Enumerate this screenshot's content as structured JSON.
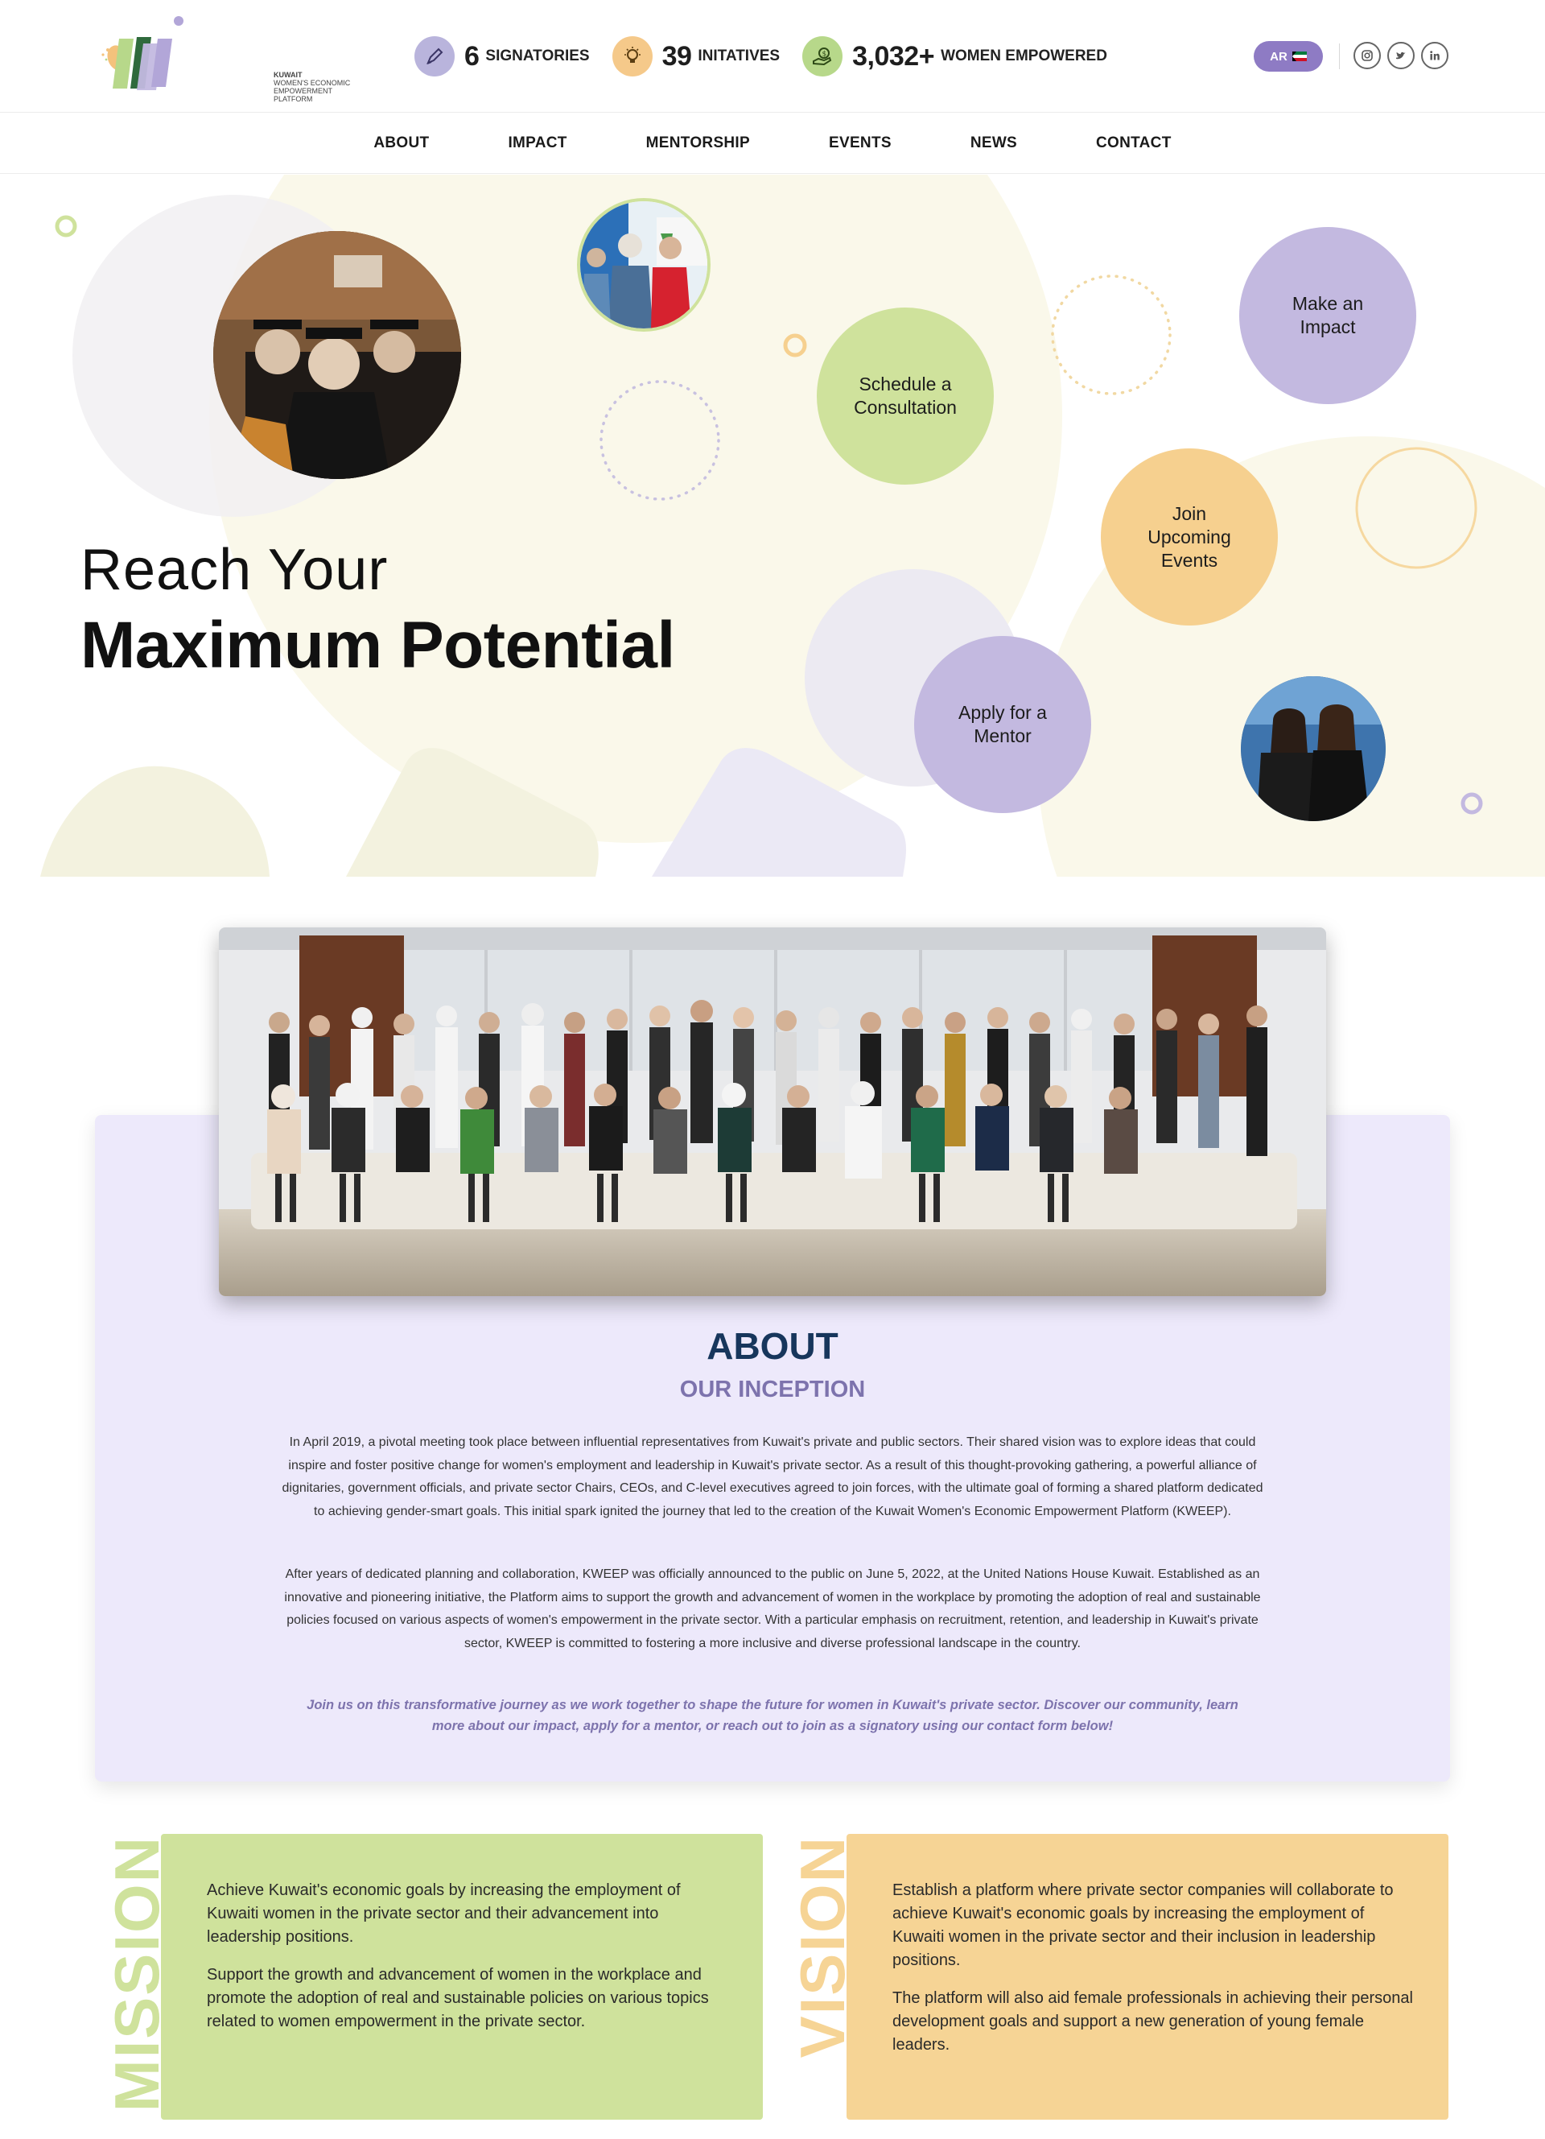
{
  "brand": {
    "logo_lines": [
      "KUWAIT",
      "WOMEN'S ECONOMIC",
      "EMPOWERMENT",
      "PLATFORM"
    ]
  },
  "stats": [
    {
      "value": "6",
      "label": "SIGNATORIES",
      "icon": "pen-icon",
      "color": "#b9b4dc"
    },
    {
      "value": "39",
      "label": "INITATIVES",
      "icon": "lightbulb-icon",
      "color": "#f5c98a"
    },
    {
      "value": "3,032+",
      "label": "WOMEN EMPOWERED",
      "icon": "hand-money-icon",
      "color": "#b7d88a"
    }
  ],
  "header": {
    "lang_label": "AR",
    "social": [
      "instagram-icon",
      "twitter-icon",
      "linkedin-icon"
    ]
  },
  "nav": {
    "items": [
      "ABOUT",
      "IMPACT",
      "MENTORSHIP",
      "EVENTS",
      "NEWS",
      "CONTACT"
    ]
  },
  "hero": {
    "line1": "Reach Your",
    "line2": "Maximum Potential",
    "bubbles": [
      {
        "label": "Schedule a Consultation",
        "color": "#cfe29c"
      },
      {
        "label": "Make an Impact",
        "color": "#c3b9e0"
      },
      {
        "label": "Join Upcoming Events",
        "color": "#f6d08f"
      },
      {
        "label": "Apply for a Mentor",
        "color": "#c3b9e0"
      }
    ]
  },
  "about": {
    "title": "ABOUT",
    "subtitle": "OUR INCEPTION",
    "paragraphs": [
      "In April 2019, a pivotal meeting took place between influential representatives from Kuwait's private and public sectors. Their shared vision was to explore ideas that could inspire and foster positive change for women's employment and leadership in Kuwait's private sector. As a result of this thought-provoking gathering, a powerful alliance of dignitaries, government officials, and private sector Chairs, CEOs, and C-level executives agreed to join forces, with the ultimate goal of forming a shared platform dedicated to achieving gender-smart goals. This initial spark ignited the journey that led to the creation of the Kuwait Women's Economic Empowerment Platform (KWEEP).",
      "After years of dedicated planning and collaboration, KWEEP was officially announced to the public on June 5, 2022, at the United Nations House Kuwait. Established as an innovative and pioneering initiative, the Platform aims to support the growth and advancement of women in the workplace by promoting the adoption of real and sustainable policies focused on various aspects of women's empowerment in the private sector. With a particular emphasis on recruitment, retention, and leadership in Kuwait's private sector, KWEEP is committed to fostering a more inclusive and diverse professional landscape in the country."
    ],
    "cta": "Join us on this transformative journey as we work together to shape the future for women in Kuwait's private sector. Discover our community, learn more about our impact, apply for a mentor, or reach out to join as a signatory using our contact form below!"
  },
  "mission": {
    "label": "MISSION",
    "color": "#cfe29c",
    "paragraphs": [
      "Achieve Kuwait's economic goals by increasing the employment of Kuwaiti women in the private sector and their advancement into leadership positions.",
      "Support the growth and advancement of women in the workplace and promote the adoption of real and sustainable policies on various topics related to women empowerment in the private sector."
    ]
  },
  "vision": {
    "label": "VISION",
    "color": "#f6d495",
    "paragraphs": [
      "Establish a platform where private sector companies will collaborate to achieve Kuwait's economic goals by increasing the employment of Kuwaiti women in the private sector and their inclusion in leadership positions.",
      "The platform will also aid female professionals in achieving their personal development goals and support a new generation of young female leaders."
    ]
  }
}
